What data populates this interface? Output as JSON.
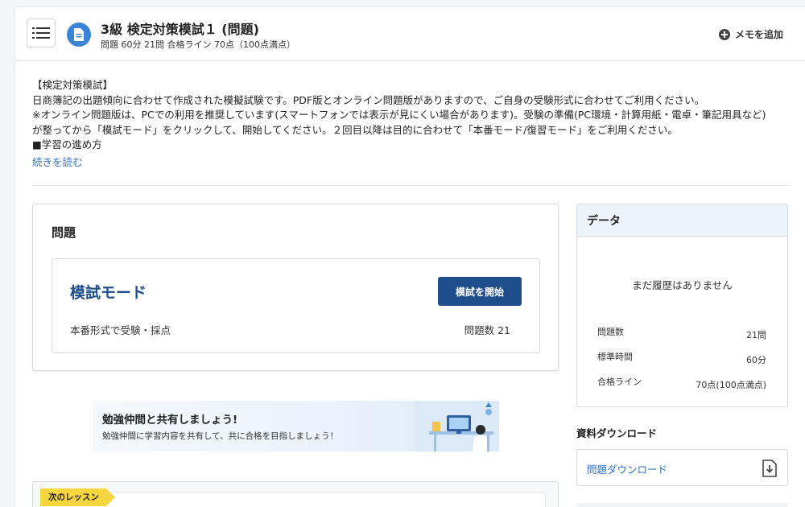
{
  "header": {
    "title": "3級 検定対策模試１ (問題)",
    "subtitle": "問題  60分  21問  合格ライン 70点（100点満点）",
    "memo_label": "メモを追加"
  },
  "description": {
    "lines": [
      "【検定対策模試】",
      "日商簿記の出題傾向に合わせて作成された模擬試験です。PDF版とオンライン問題版がありますので、ご自身の受験形式に合わせてご利用ください。",
      "※オンライン問題版は、PCでの利用を推奨しています(スマートフォンでは表示が見にくい場合があります)。受験の準備(PC環境・計算用紙・電卓・筆記用具など)",
      "が整ってから「模試モード」をクリックして、開始してください。２回目以降は目的に合わせて「本番モード/復習モード」をご利用ください。",
      "■学習の進め方"
    ],
    "read_more": "続きを読む"
  },
  "question_card": {
    "title": "問題",
    "mode_title": "模試モード",
    "start_button": "模試を開始",
    "mode_description": "本番形式で受験・採点",
    "question_count": "問題数 21"
  },
  "banner": {
    "title": "勉強仲間と共有しましょう!",
    "text": "勉強仲間に学習内容を共有して、共に合格を目指しましょう！"
  },
  "next_lesson": {
    "tag": "次のレッスン"
  },
  "data_card": {
    "title": "データ",
    "empty_text": "まだ履歴はありません",
    "stats": [
      {
        "label": "問題数",
        "value": "21問"
      },
      {
        "label": "標準時間",
        "value": "60分"
      },
      {
        "label": "合格ライン",
        "value": "70点(100点満点)"
      }
    ]
  },
  "downloads": {
    "heading": "資料ダウンロード",
    "items": [
      {
        "label": "問題ダウンロード"
      }
    ]
  },
  "colors": {
    "accent_blue": "#1f4e8c",
    "link_blue": "#2e6fc0",
    "icon_blue": "#3a84d6",
    "tag_yellow": "#f7d53e"
  }
}
